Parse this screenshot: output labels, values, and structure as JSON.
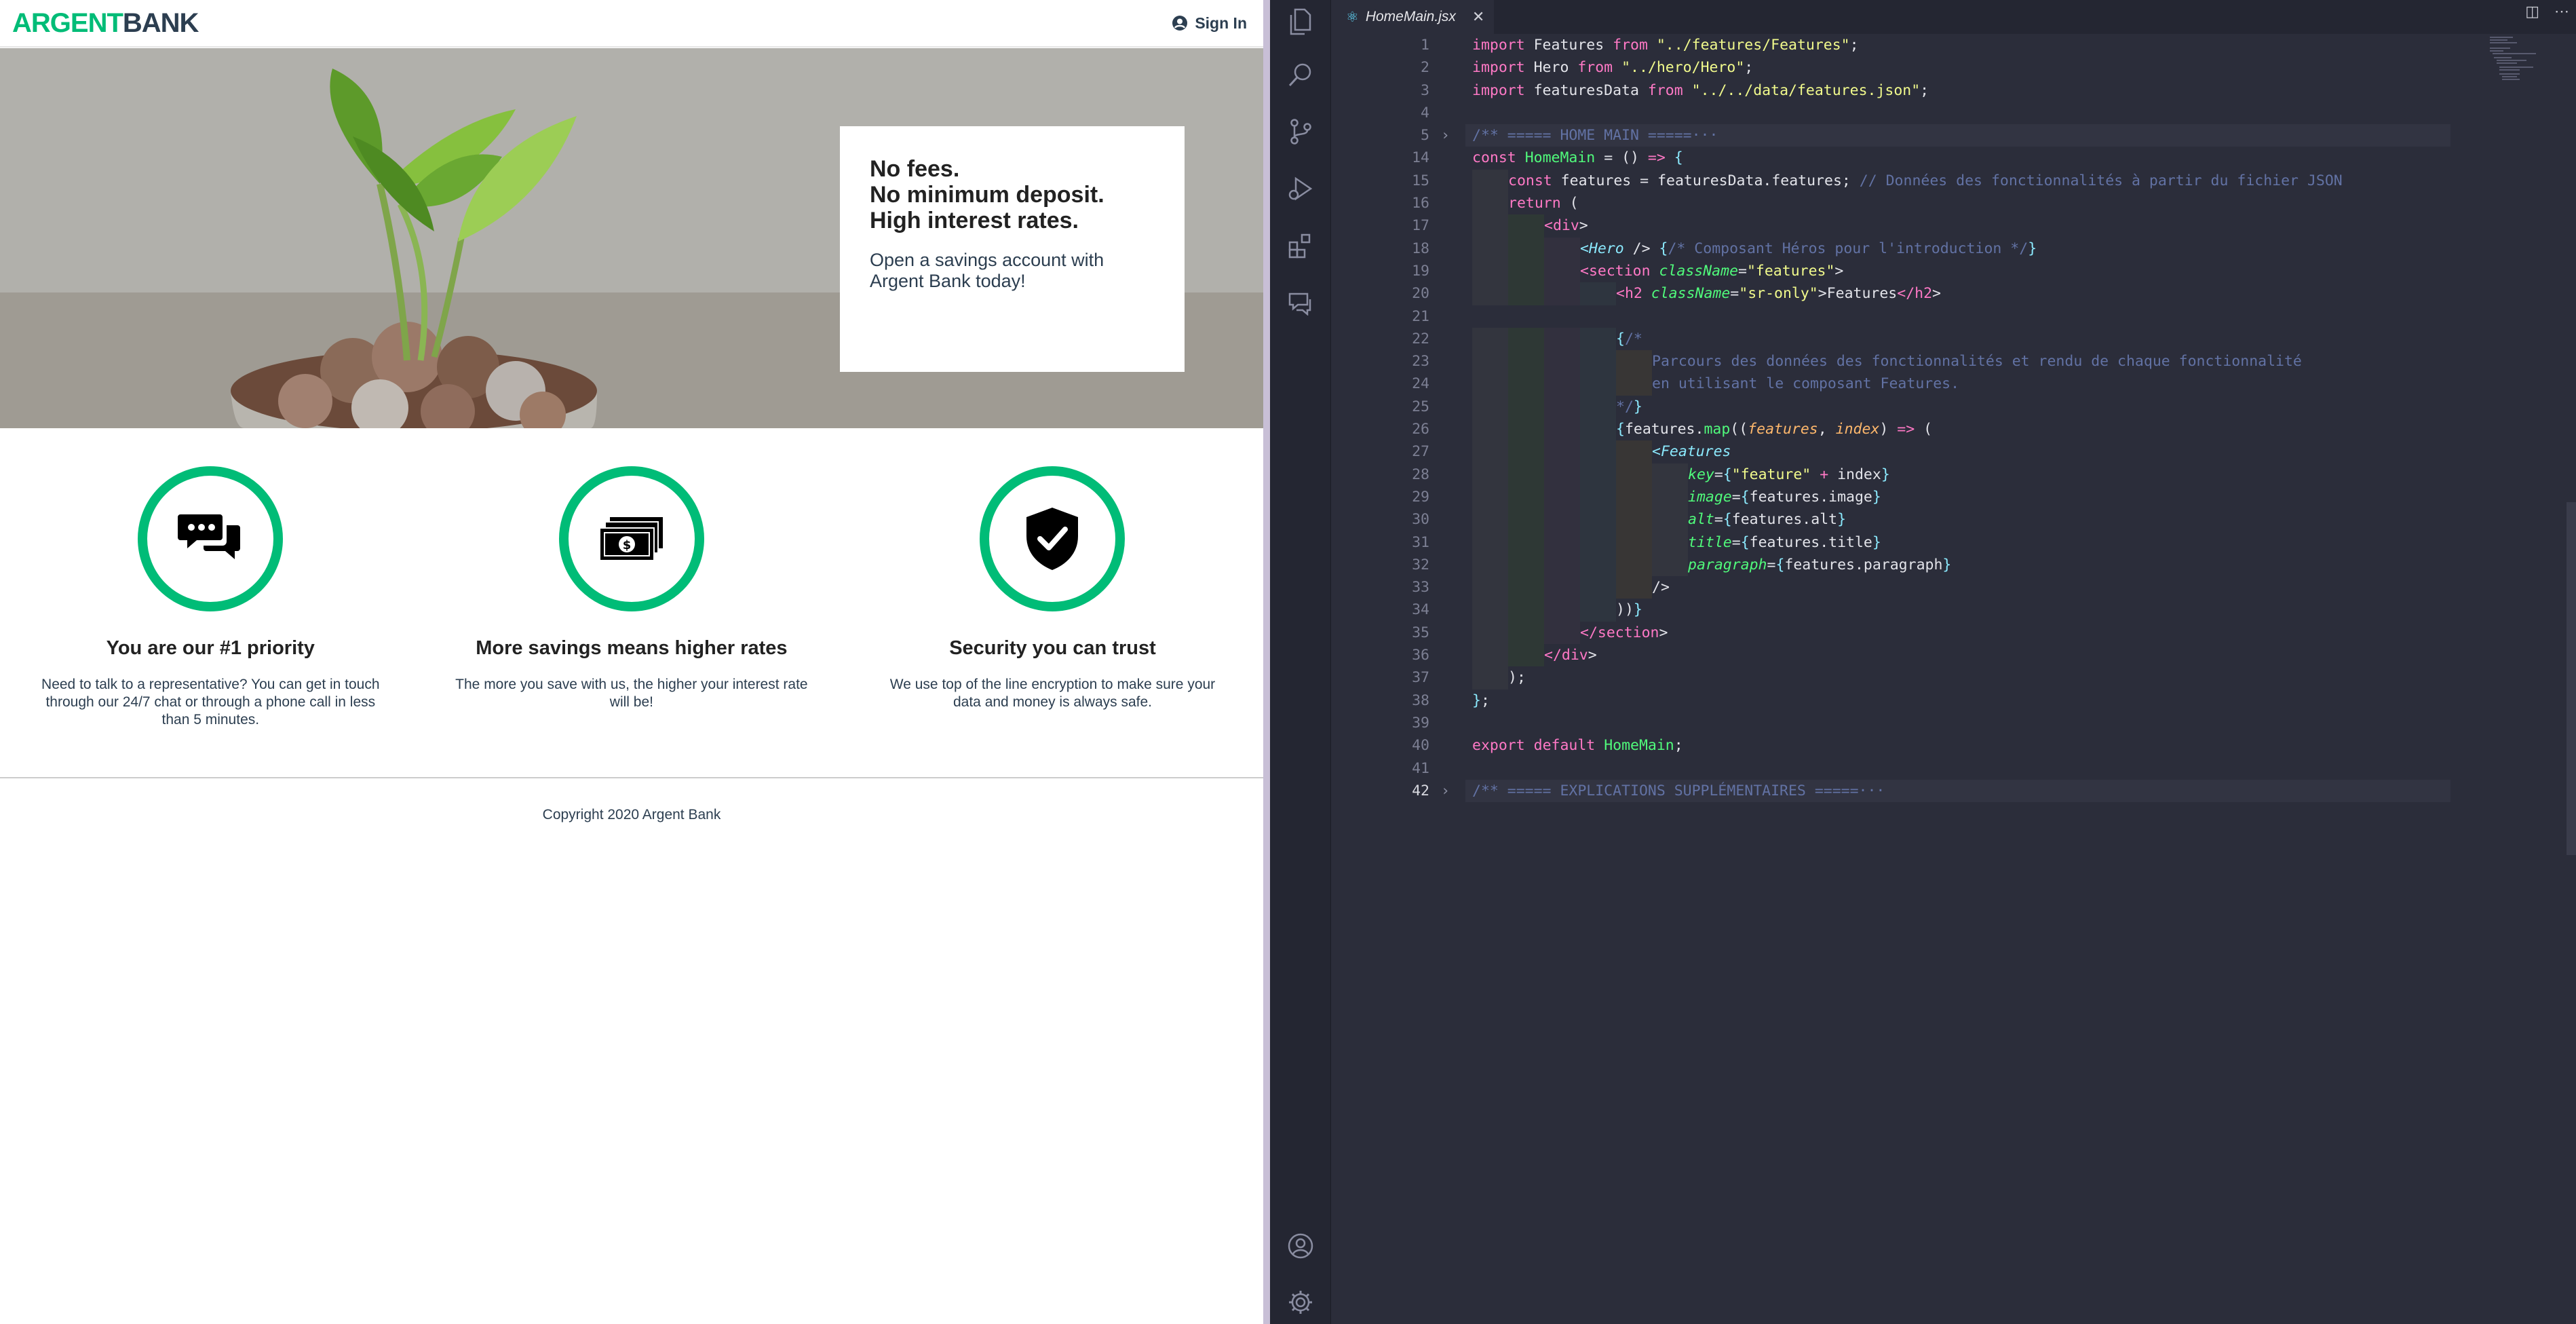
{
  "web": {
    "logo_argent": "ARGENT",
    "logo_bank": "BANK",
    "nav": {
      "sign_in": "Sign In"
    },
    "hero": {
      "subtitles": [
        "No fees.",
        "No minimum deposit.",
        "High interest rates."
      ],
      "text": "Open a savings account with Argent Bank today!"
    },
    "features": [
      {
        "icon": "chat-icon",
        "title": "You are our #1 priority",
        "paragraph": "Need to talk to a representative? You can get in touch through our 24/7 chat or through a phone call in less than 5 minutes."
      },
      {
        "icon": "money-icon",
        "title": "More savings means higher rates",
        "paragraph": "The more you save with us, the higher your interest rate will be!"
      },
      {
        "icon": "security-icon",
        "title": "Security you can trust",
        "paragraph": "We use top of the line encryption to make sure your data and money is always safe."
      }
    ],
    "footer": "Copyright 2020 Argent Bank"
  },
  "editor": {
    "tab_name": "HomeMain.jsx",
    "activity_icons": [
      "files-icon",
      "search-icon",
      "source-control-icon",
      "run-debug-icon",
      "extensions-icon",
      "chat-icon",
      "account-icon",
      "settings-gear-icon"
    ],
    "tab_actions": [
      "split-editor-icon",
      "more-actions-icon"
    ],
    "current_line": 42,
    "lines": [
      {
        "n": "1",
        "code": "import Features from \"../features/Features\";"
      },
      {
        "n": "2",
        "code": "import Hero from \"../hero/Hero\";"
      },
      {
        "n": "3",
        "code": "import featuresData from \"../../data/features.json\";"
      },
      {
        "n": "4",
        "code": ""
      },
      {
        "n": "5",
        "code": "/** ===== HOME MAIN =====···",
        "folded": true
      },
      {
        "n": "14",
        "code": "const HomeMain = () => {"
      },
      {
        "n": "15",
        "code": "    const features = featuresData.features; // Données des fonctionnalités à partir du fichier JSON"
      },
      {
        "n": "16",
        "code": "    return ("
      },
      {
        "n": "17",
        "code": "        <div>"
      },
      {
        "n": "18",
        "code": "            <Hero /> {/* Composant Héros pour l'introduction */}"
      },
      {
        "n": "19",
        "code": "            <section className=\"features\">"
      },
      {
        "n": "20",
        "code": "                <h2 className=\"sr-only\">Features</h2>"
      },
      {
        "n": "21",
        "code": ""
      },
      {
        "n": "22",
        "code": "                {/*"
      },
      {
        "n": "23",
        "code": "                    Parcours des données des fonctionnalités et rendu de chaque fonctionnalité"
      },
      {
        "n": "24",
        "code": "                    en utilisant le composant Features."
      },
      {
        "n": "25",
        "code": "                */}"
      },
      {
        "n": "26",
        "code": "                {features.map((features, index) => ("
      },
      {
        "n": "27",
        "code": "                    <Features"
      },
      {
        "n": "28",
        "code": "                        key={\"feature\" + index}"
      },
      {
        "n": "29",
        "code": "                        image={features.image}"
      },
      {
        "n": "30",
        "code": "                        alt={features.alt}"
      },
      {
        "n": "31",
        "code": "                        title={features.title}"
      },
      {
        "n": "32",
        "code": "                        paragraph={features.paragraph}"
      },
      {
        "n": "33",
        "code": "                    />"
      },
      {
        "n": "34",
        "code": "                ))}"
      },
      {
        "n": "35",
        "code": "            </section>"
      },
      {
        "n": "36",
        "code": "        </div>"
      },
      {
        "n": "37",
        "code": "    );"
      },
      {
        "n": "38",
        "code": "};"
      },
      {
        "n": "39",
        "code": ""
      },
      {
        "n": "40",
        "code": "export default HomeMain;"
      },
      {
        "n": "41",
        "code": ""
      },
      {
        "n": "42",
        "code": "/** ===== EXPLICATIONS SUPPLÉMENTAIRES =====···",
        "folded": true
      }
    ]
  }
}
